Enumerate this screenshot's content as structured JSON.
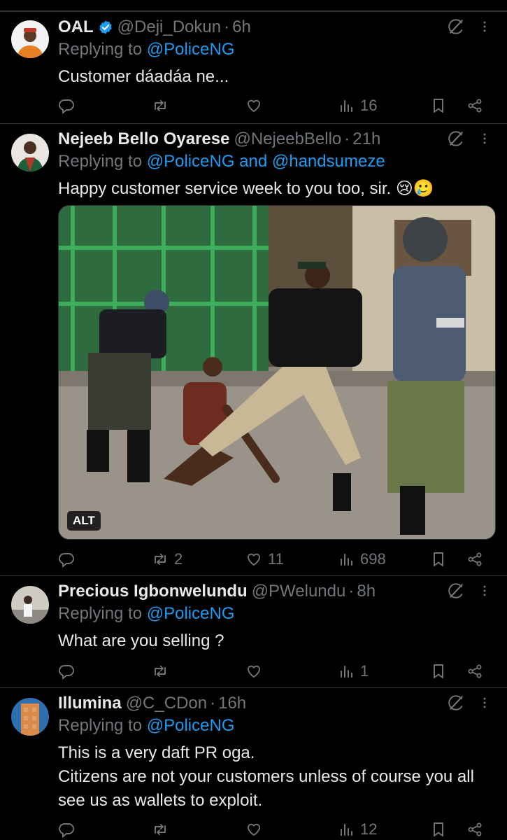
{
  "tweets": [
    {
      "name": "OAL",
      "handle": "@Deji_Dokun",
      "time": "6h",
      "replying_prefix": "Replying to",
      "replying_to": "@PoliceNG",
      "text": "Customer dáadáa ne...",
      "stats": {
        "replies": "",
        "reposts": "",
        "likes": "",
        "views": "16"
      }
    },
    {
      "name": "Nejeeb Bello Oyarese",
      "handle": "@NejeebBello",
      "time": "21h",
      "replying_prefix": "Replying to",
      "replying_to": "@PoliceNG",
      "replying_and": "and",
      "replying_to_2": "@handsumeze",
      "text": "Happy customer service week to you too, sir. 😢🥲",
      "media_alt_badge": "ALT",
      "stats": {
        "replies": "",
        "reposts": "2",
        "likes": "11",
        "views": "698"
      }
    },
    {
      "name": "Precious Igbonwelundu",
      "handle": "@PWelundu",
      "time": "8h",
      "replying_prefix": "Replying to",
      "replying_to": "@PoliceNG",
      "text": "What are you selling ?",
      "stats": {
        "replies": "",
        "reposts": "",
        "likes": "",
        "views": "1"
      }
    },
    {
      "name": "Illumina",
      "handle": "@C_CDon",
      "time": "16h",
      "replying_prefix": "Replying to",
      "replying_to": "@PoliceNG",
      "text_line1": "This is a very daft PR oga.",
      "text_line2": "Citizens are not your customers unless of course you all see us as wallets to exploit.",
      "stats": {
        "replies": "",
        "reposts": "",
        "likes": "",
        "views": "12"
      }
    }
  ],
  "colors": {
    "background": "#000000",
    "text": "#e7e9ea",
    "muted": "#71767b",
    "link": "#1d9bf0",
    "divider": "#2f3336",
    "verified": "#1d9bf0"
  },
  "icons": [
    "verified-badge-icon",
    "grok-icon",
    "more-icon",
    "reply-icon",
    "repost-icon",
    "like-icon",
    "views-icon",
    "bookmark-icon",
    "share-icon"
  ]
}
